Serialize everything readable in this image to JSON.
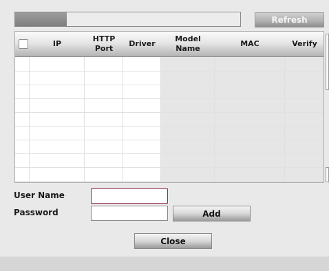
{
  "progress": {
    "value_percent": 23
  },
  "toolbar": {
    "refresh_label": "Refresh"
  },
  "table": {
    "headers": {
      "ip": "IP",
      "http_port_line1": "HTTP",
      "http_port_line2": "Port",
      "driver": "Driver",
      "model_name_line1": "Model",
      "model_name_line2": "Name",
      "mac": "MAC",
      "verify": "Verify"
    },
    "rows": []
  },
  "form": {
    "username_label": "User Name",
    "username_value": "",
    "password_label": "Password",
    "password_value": "",
    "add_label": "Add"
  },
  "footer": {
    "close_label": "Close"
  },
  "colors": {
    "input_focus_border": "#9a2a5a"
  }
}
